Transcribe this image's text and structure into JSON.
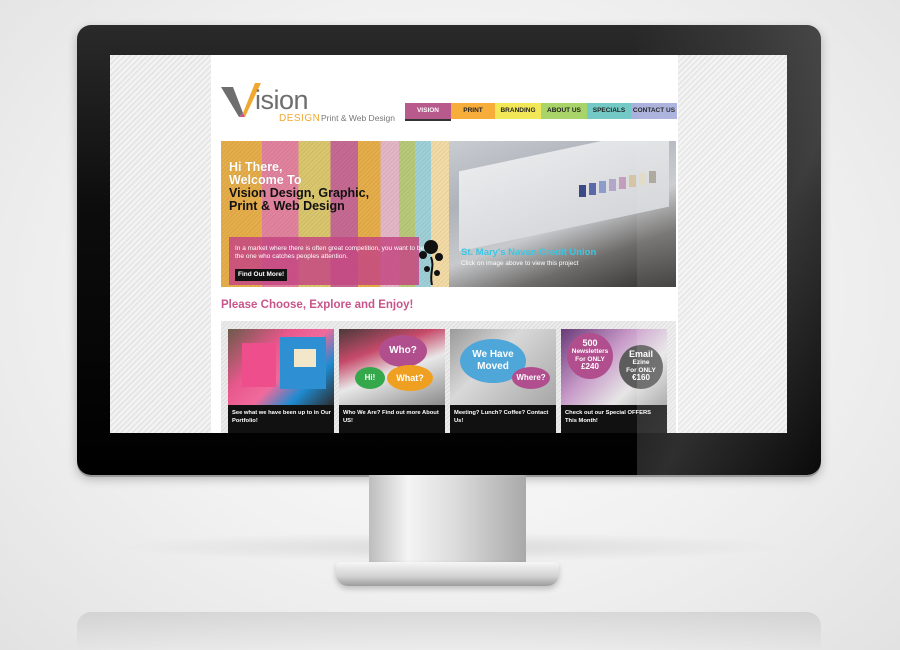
{
  "logo": {
    "word": "ision",
    "design": "DESIGN",
    "tagline": "Print & Web Design"
  },
  "nav": {
    "items": [
      {
        "label": "VISION",
        "color": "#b85a8c",
        "text": "#ffffff"
      },
      {
        "label": "PRINT",
        "color": "#f7ad3a",
        "text": "#222222"
      },
      {
        "label": "BRANDING",
        "color": "#f2e857",
        "text": "#222222"
      },
      {
        "label": "ABOUT US",
        "color": "#a8d46a",
        "text": "#222222"
      },
      {
        "label": "SPECIALS",
        "color": "#73c9c6",
        "text": "#222222"
      },
      {
        "label": "CONTACT US",
        "color": "#a9b0dc",
        "text": "#222222"
      }
    ]
  },
  "hero": {
    "title_l1": "Hi There,",
    "title_l2": "Welcome To",
    "title_l3": "Vision Design, Graphic,",
    "title_l4": "Print & Web Design",
    "tagline": "In a market where there is often great competition, you want to be the one who catches peoples attention.",
    "button": "Find Out More!",
    "project_title": "St. Mary's Navan Credit Union",
    "project_sub": "Click on image above to view this project"
  },
  "section_title": "Please Choose, Explore and Enjoy!",
  "cards": [
    {
      "caption": "See what we have been up to in Our Portfolio!"
    },
    {
      "caption": "Who We Are? Find out more About US!",
      "b1": "Who?",
      "b2": "Hi!",
      "b3": "What?"
    },
    {
      "caption": "Meeting? Lunch? Coffee? Contact Us!",
      "b1": "We Have Moved",
      "b2": "Where?"
    },
    {
      "caption": "Check out our Special OFFERS This Month!",
      "b1_l1": "500",
      "b1_l2": "Newsletters",
      "b1_l3": "For ONLY",
      "b1_l4": "£240",
      "b2_l1": "Email",
      "b2_l2": "Ezine",
      "b2_l3": "For ONLY",
      "b2_l4": "€160"
    }
  ]
}
